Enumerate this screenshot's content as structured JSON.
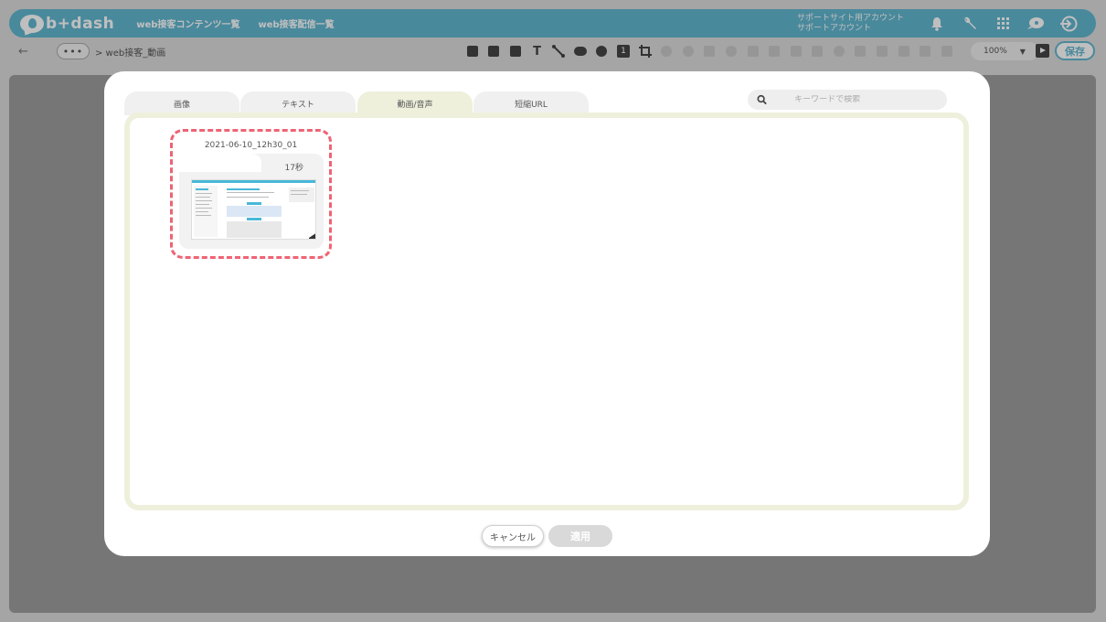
{
  "header": {
    "logo_text": "b+dash",
    "nav": [
      "web接客コンテンツ一覧",
      "web接客配信一覧"
    ],
    "account_line1": "サポートサイト用アカウント",
    "account_line2": "サポートアカウント",
    "brand_color": "#62b7d0",
    "icons": [
      "bell-icon",
      "wrench-icon",
      "grid-icon",
      "chat-icon",
      "logout-icon"
    ]
  },
  "toolbar": {
    "back_arrow": "←",
    "more": "•••",
    "breadcrumb": "> web接客_動画",
    "tool_icons": [
      "list-icon",
      "image-icon",
      "video-icon",
      "text-icon",
      "line-icon",
      "toggle-icon",
      "close-circle-icon",
      "number-icon",
      "crop-icon",
      "undo-icon",
      "redo-icon",
      "text-box-icon",
      "drop-icon",
      "expand-icon",
      "layer-icon",
      "square-icon",
      "pen-icon",
      "link-icon",
      "calendar-icon",
      "table-icon",
      "database-icon",
      "people-icon",
      "copy-icon"
    ],
    "text_tool": "T",
    "number_tool": "1",
    "zoom": "100%",
    "save_label": "保存"
  },
  "modal": {
    "tabs": [
      "画像",
      "テキスト",
      "動画/音声",
      "短縮URL"
    ],
    "active_tab": 2,
    "active_color": "#eef0dc",
    "search_placeholder": "キーワードで検索",
    "media": [
      {
        "name": "2021-06-10_12h30_01",
        "duration": "17秒",
        "selected": true
      }
    ],
    "selected_color": "#ef6374",
    "cancel_label": "キャンセル",
    "apply_label": "適用"
  }
}
